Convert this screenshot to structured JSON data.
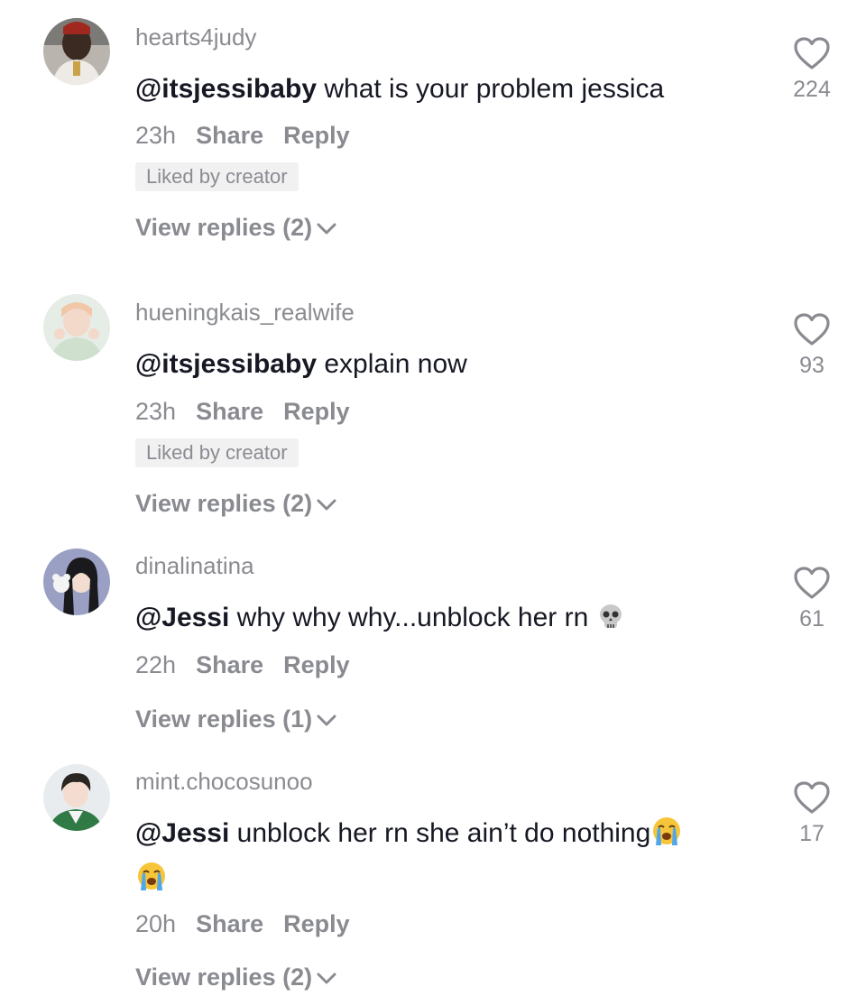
{
  "comments": [
    {
      "username": "hearts4judy",
      "mention": "@itsjessibaby",
      "text": " what is your problem jessica",
      "time": "23h",
      "share_label": "Share",
      "reply_label": "Reply",
      "liked_badge": "Liked by creator",
      "view_replies": "View replies (2)",
      "likes": "224"
    },
    {
      "username": "hueningkais_realwife",
      "mention": "@itsjessibaby",
      "text": " explain now",
      "time": "23h",
      "share_label": "Share",
      "reply_label": "Reply",
      "liked_badge": "Liked by creator",
      "view_replies": "View replies (2)",
      "likes": "93"
    },
    {
      "username": "dinalinatina",
      "mention": "@Jessi",
      "text": " why why why...unblock her rn ",
      "time": "22h",
      "share_label": "Share",
      "reply_label": "Reply",
      "view_replies": "View replies (1)",
      "likes": "61"
    },
    {
      "username": "mint.chocosunoo",
      "mention": "@Jessi",
      "text": " unblock her rn she ain’t do nothing",
      "time": "20h",
      "share_label": "Share",
      "reply_label": "Reply",
      "view_replies": "View replies (2)",
      "likes": "17"
    }
  ],
  "icons": {
    "like": "heart-outline-icon",
    "expand": "chevron-down-icon",
    "skull": "skull-emoji",
    "crying": "loudly-crying-emoji"
  },
  "colors": {
    "text": "#161823",
    "muted": "#8a8b91",
    "badge_bg": "#f1f1f2"
  }
}
